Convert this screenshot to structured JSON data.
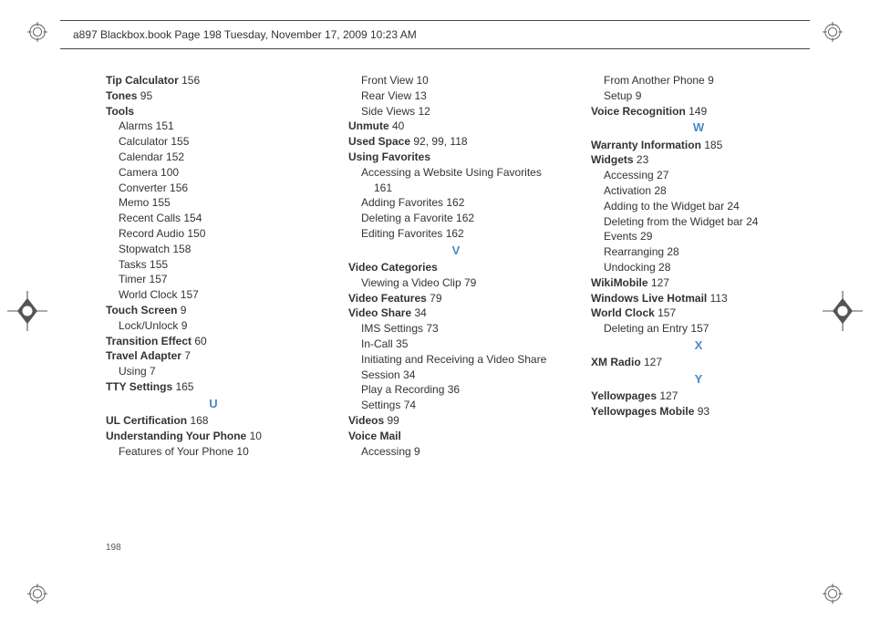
{
  "header": "a897 Blackbox.book  Page 198  Tuesday, November 17, 2009  10:23 AM",
  "page_number": "198",
  "columns": [
    [
      {
        "type": "line",
        "bold": true,
        "text": "Tip Calculator",
        "pg": "156"
      },
      {
        "type": "line",
        "bold": true,
        "text": "Tones",
        "pg": "95"
      },
      {
        "type": "line",
        "bold": true,
        "text": "Tools"
      },
      {
        "type": "sub",
        "text": "Alarms",
        "pg": "151"
      },
      {
        "type": "sub",
        "text": "Calculator",
        "pg": "155"
      },
      {
        "type": "sub",
        "text": "Calendar",
        "pg": "152"
      },
      {
        "type": "sub",
        "text": "Camera",
        "pg": "100"
      },
      {
        "type": "sub",
        "text": "Converter",
        "pg": "156"
      },
      {
        "type": "sub",
        "text": "Memo",
        "pg": "155"
      },
      {
        "type": "sub",
        "text": "Recent Calls",
        "pg": "154"
      },
      {
        "type": "sub",
        "text": "Record Audio",
        "pg": "150"
      },
      {
        "type": "sub",
        "text": "Stopwatch",
        "pg": "158"
      },
      {
        "type": "sub",
        "text": "Tasks",
        "pg": "155"
      },
      {
        "type": "sub",
        "text": "Timer",
        "pg": "157"
      },
      {
        "type": "sub",
        "text": "World Clock",
        "pg": "157"
      },
      {
        "type": "line",
        "bold": true,
        "text": "Touch Screen",
        "pg": "9"
      },
      {
        "type": "sub",
        "text": "Lock/Unlock",
        "pg": "9"
      },
      {
        "type": "line",
        "bold": true,
        "text": "Transition Effect",
        "pg": "60"
      },
      {
        "type": "line",
        "bold": true,
        "text": "Travel Adapter",
        "pg": "7"
      },
      {
        "type": "sub",
        "text": "Using",
        "pg": "7"
      },
      {
        "type": "line",
        "bold": true,
        "text": "TTY Settings",
        "pg": "165"
      },
      {
        "type": "letter",
        "text": "U"
      },
      {
        "type": "line",
        "bold": true,
        "text": "UL Certification",
        "pg": "168"
      },
      {
        "type": "line",
        "bold": true,
        "text": "Understanding Your Phone",
        "pg": "10"
      },
      {
        "type": "sub",
        "text": "Features of Your Phone",
        "pg": "10"
      }
    ],
    [
      {
        "type": "sub",
        "text": "Front View",
        "pg": "10"
      },
      {
        "type": "sub",
        "text": "Rear View",
        "pg": "13"
      },
      {
        "type": "sub",
        "text": "Side Views",
        "pg": "12"
      },
      {
        "type": "line",
        "bold": true,
        "text": "Unmute",
        "pg": "40"
      },
      {
        "type": "line",
        "bold": true,
        "text": "Used Space",
        "pg": "92, 99, 118"
      },
      {
        "type": "line",
        "bold": true,
        "text": "Using Favorites"
      },
      {
        "type": "sub",
        "wrap": true,
        "text": "Accessing a Website Using Favorites",
        "pg": "161",
        "pgIndent": true
      },
      {
        "type": "sub",
        "text": "Adding Favorites",
        "pg": "162"
      },
      {
        "type": "sub",
        "text": "Deleting a Favorite",
        "pg": "162"
      },
      {
        "type": "sub",
        "text": "Editing Favorites",
        "pg": "162"
      },
      {
        "type": "letter",
        "text": "V"
      },
      {
        "type": "line",
        "bold": true,
        "text": "Video Categories"
      },
      {
        "type": "sub",
        "text": "Viewing a Video Clip",
        "pg": "79"
      },
      {
        "type": "line",
        "bold": true,
        "text": "Video Features",
        "pg": "79"
      },
      {
        "type": "line",
        "bold": true,
        "text": "Video Share",
        "pg": "34"
      },
      {
        "type": "sub",
        "text": "IMS Settings",
        "pg": "73"
      },
      {
        "type": "sub",
        "text": "In-Call",
        "pg": "35"
      },
      {
        "type": "sub",
        "wrap": true,
        "text": "Initiating and Receiving a Video Share Session",
        "pg": "34",
        "pgInline": true,
        "secondLineIndent": true
      },
      {
        "type": "sub",
        "text": "Play a Recording",
        "pg": "36"
      },
      {
        "type": "sub",
        "text": "Settings",
        "pg": "74"
      },
      {
        "type": "line",
        "bold": true,
        "text": "Videos",
        "pg": "99"
      },
      {
        "type": "line",
        "bold": true,
        "text": "Voice Mail"
      },
      {
        "type": "sub",
        "text": "Accessing",
        "pg": "9"
      }
    ],
    [
      {
        "type": "sub",
        "text": "From Another Phone",
        "pg": "9"
      },
      {
        "type": "sub",
        "text": "Setup",
        "pg": "9"
      },
      {
        "type": "line",
        "bold": true,
        "text": "Voice Recognition",
        "pg": "149"
      },
      {
        "type": "letter",
        "text": "W"
      },
      {
        "type": "line",
        "bold": true,
        "text": "Warranty Information",
        "pg": "185"
      },
      {
        "type": "line",
        "bold": true,
        "text": "Widgets",
        "pg": "23"
      },
      {
        "type": "sub",
        "text": "Accessing",
        "pg": "27"
      },
      {
        "type": "sub",
        "text": "Activation",
        "pg": "28"
      },
      {
        "type": "sub",
        "text": "Adding to the Widget bar",
        "pg": "24"
      },
      {
        "type": "sub",
        "text": "Deleting from the Widget bar",
        "pg": "24"
      },
      {
        "type": "sub",
        "text": "Events",
        "pg": "29"
      },
      {
        "type": "sub",
        "text": "Rearranging",
        "pg": "28"
      },
      {
        "type": "sub",
        "text": "Undocking",
        "pg": "28"
      },
      {
        "type": "line",
        "bold": true,
        "text": "WikiMobile",
        "pg": "127"
      },
      {
        "type": "line",
        "bold": true,
        "text": "Windows Live Hotmail",
        "pg": "113"
      },
      {
        "type": "line",
        "bold": true,
        "text": "World Clock",
        "pg": "157"
      },
      {
        "type": "sub",
        "text": "Deleting an Entry",
        "pg": "157"
      },
      {
        "type": "letter",
        "text": "X"
      },
      {
        "type": "line",
        "bold": true,
        "text": "XM Radio",
        "pg": "127"
      },
      {
        "type": "letter",
        "text": "Y"
      },
      {
        "type": "line",
        "bold": true,
        "text": "Yellowpages",
        "pg": "127"
      },
      {
        "type": "line",
        "bold": true,
        "text": "Yellowpages Mobile",
        "pg": "93"
      }
    ]
  ]
}
